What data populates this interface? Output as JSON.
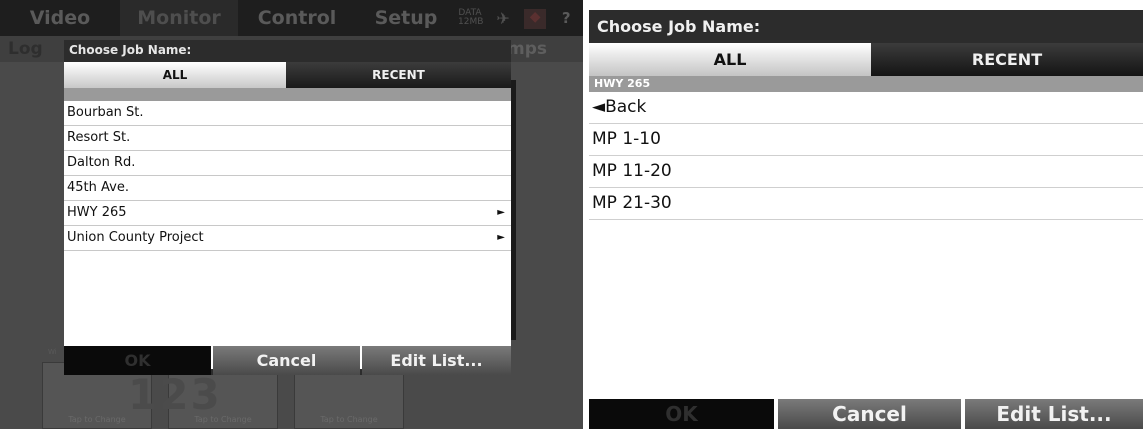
{
  "background": {
    "tabs": [
      "Video",
      "Monitor",
      "Control",
      "Setup"
    ],
    "active_tab": "Monitor",
    "data_indicator": [
      "DATA",
      "12MB"
    ],
    "help_label": "?",
    "sub_left": "Log",
    "sub_right": "mps",
    "tile_number": "123",
    "tile_caption": "Tap to Change",
    "tile_label": "Wi"
  },
  "left_dialog": {
    "title": "Choose Job Name:",
    "segments": {
      "all": "ALL",
      "recent": "RECENT"
    },
    "active_segment": "ALL",
    "items": [
      {
        "label": "Bourban St.",
        "has_children": false
      },
      {
        "label": "Resort St.",
        "has_children": false
      },
      {
        "label": "Dalton Rd.",
        "has_children": false
      },
      {
        "label": "45th Ave.",
        "has_children": false
      },
      {
        "label": "HWY 265",
        "has_children": true
      },
      {
        "label": "Union County Project",
        "has_children": true
      }
    ],
    "buttons": {
      "ok": "OK",
      "cancel": "Cancel",
      "edit": "Edit List..."
    }
  },
  "right_dialog": {
    "title": "Choose Job Name:",
    "segments": {
      "all": "ALL",
      "recent": "RECENT"
    },
    "active_segment": "ALL",
    "breadcrumb": "HWY 265",
    "back_label": "◄Back",
    "items": [
      "MP 1-10",
      "MP 11-20",
      "MP 21-30"
    ],
    "buttons": {
      "ok": "OK",
      "cancel": "Cancel",
      "edit": "Edit List..."
    }
  },
  "colors": {
    "dialog_bg": "#2c2c2c",
    "segment_active": "#ffffff",
    "segment_inactive": "#1a1a1a",
    "breadcrumb_bg": "#9a9a9a",
    "button_bg": "#5e5e5e",
    "ok_disabled_bg": "#0a0a0a"
  }
}
